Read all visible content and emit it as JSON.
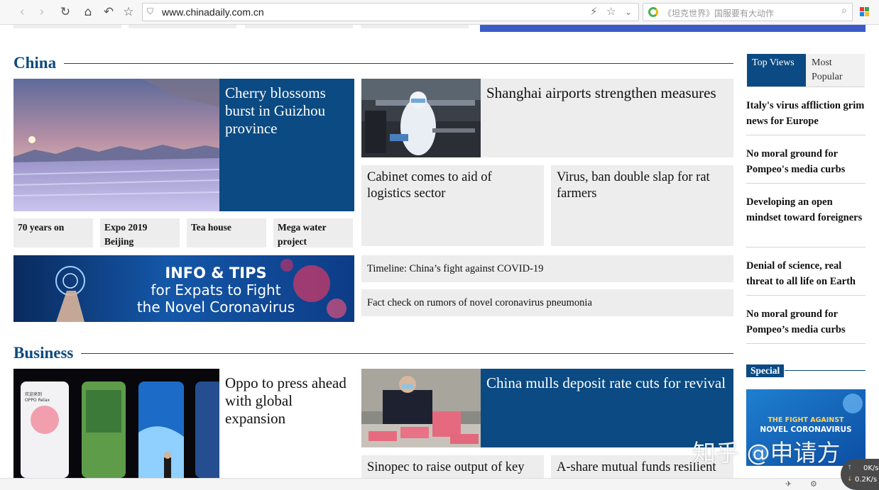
{
  "browser": {
    "url": "www.chinadaily.com.cn",
    "search_placeholder": "《坦克世界》国服要有大动作"
  },
  "china": {
    "section_title": "China",
    "feature_title": "Cherry blossoms burst in Guizhou province",
    "top_right_title": "Shanghai airports strengthen measures",
    "card_left": "Cabinet comes to aid of logistics sector",
    "card_right": "Virus, ban double slap for rat farmers",
    "tags": [
      "70 years on",
      "Expo 2019 Beijing",
      "Tea house",
      "Mega water project"
    ],
    "banner": {
      "line1": "INFO & TIPS",
      "line2": "for Expats to Fight",
      "line3": "the Novel Coronavirus"
    },
    "link1": "Timeline: China’s fight against COVID-19",
    "link2": "Fact check on rumors of novel coronavirus pneumonia"
  },
  "business": {
    "section_title": "Business",
    "feature_title": "Oppo to press ahead with global expansion",
    "phone_caption": "欢迎来到 OPPO Relax",
    "right_title": "China mulls deposit rate cuts for revival",
    "card_left": "Sinopec to raise output of key",
    "card_right": "A-share mutual funds resilient"
  },
  "sidebar": {
    "tab_active": "Top Views",
    "tab_inactive": "Most Popular",
    "items": [
      "Italy's virus affliction grim news for Europe",
      "No moral ground for Pompeo's media curbs",
      "Developing an open mindset toward foreigners",
      "Denial of science, real threat to all life on Earth",
      "No moral ground for Pompeo’s media curbs"
    ],
    "special_label": "Special",
    "special_banner": {
      "line1": "THE FIGHT AGAINST",
      "line2": "NOVEL CORONAVIRUS"
    }
  },
  "overlay": {
    "watermark": "知乎 @申请方",
    "net_up": "0K/s",
    "net_down": "0.2K/s"
  },
  "colors": {
    "brand_blue": "#0b4a82",
    "card_grey": "#ededed"
  }
}
